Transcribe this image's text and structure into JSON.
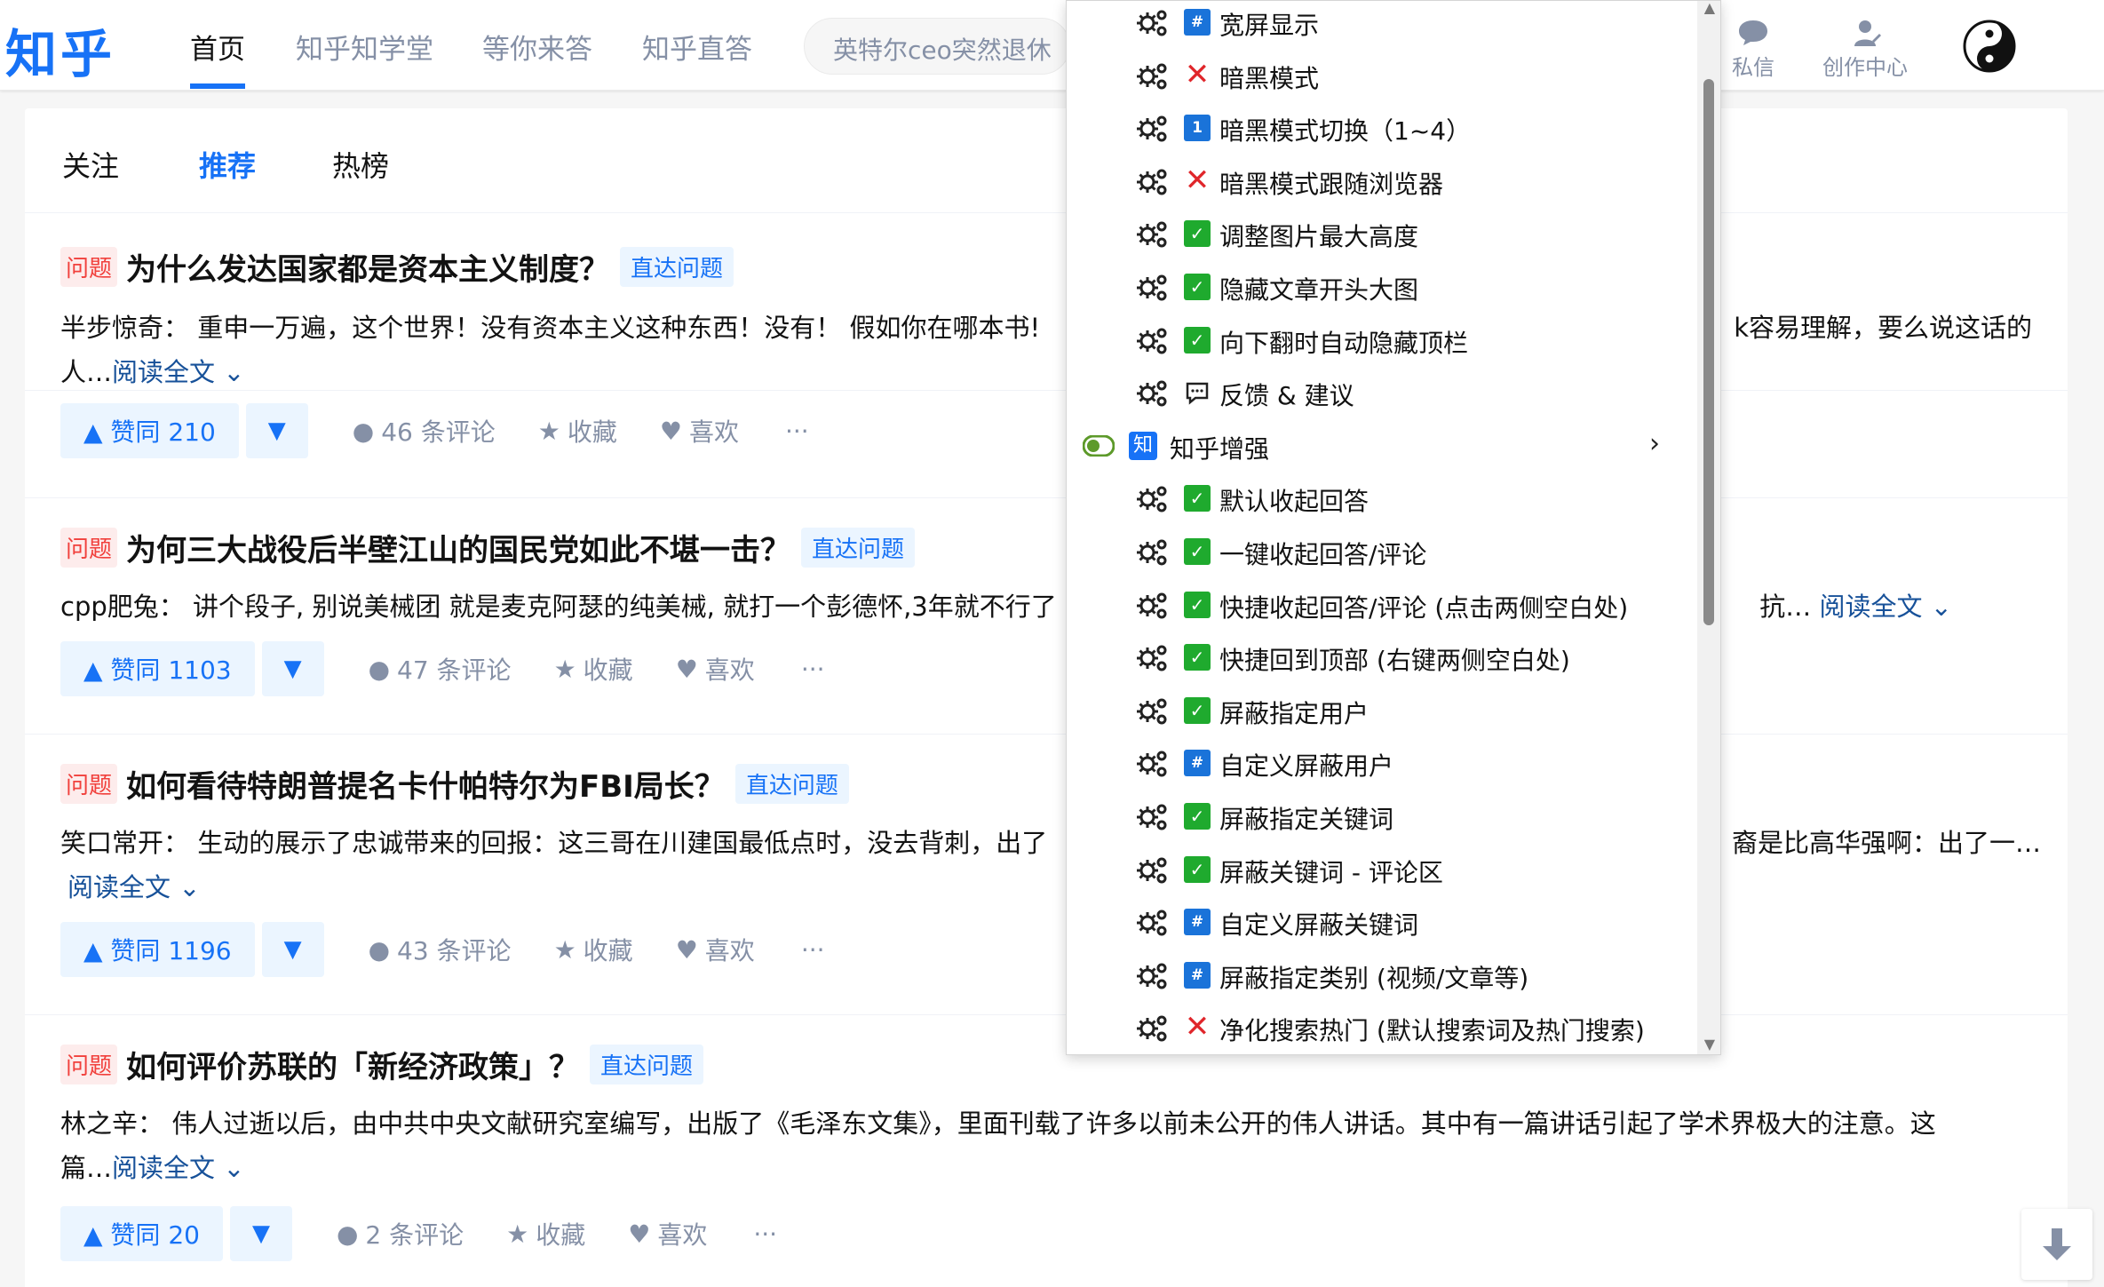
{
  "header": {
    "logo": "知乎",
    "nav": [
      "首页",
      "知乎知学堂",
      "等你来答",
      "知乎直答"
    ],
    "search_placeholder": "英特尔ceo突然退休",
    "messages": "私信",
    "creator": "创作中心"
  },
  "tabs": [
    "关注",
    "推荐",
    "热榜"
  ],
  "feed": [
    {
      "tag": "问题",
      "title": "为什么发达国家都是资本主义制度？",
      "link": "直达问题",
      "excerpt_left": "半步惊奇： 重申一万遍，这个世界！没有资本主义这种东西！没有！ 假如你在哪本书!",
      "excerpt_right": "k容易理解，要么说这话的",
      "excerpt_line2": "人…",
      "read_more": "阅读全文 ⌄",
      "votes": "▲ 赞同 210",
      "comments": "46 条评论",
      "favorite": "收藏",
      "like": "喜欢",
      "more": "···"
    },
    {
      "tag": "问题",
      "title": "为何三大战役后半壁江山的国民党如此不堪一击？",
      "link": "直达问题",
      "excerpt_left": "cpp肥兔： 讲个段子, 别说美械团 就是麦克阿瑟的纯美械, 就打一个彭德怀,3年就不行了",
      "excerpt_right": "抗…",
      "excerpt_line2": "",
      "read_more": "阅读全文 ⌄",
      "votes": "▲ 赞同 1103",
      "comments": "47 条评论",
      "favorite": "收藏",
      "like": "喜欢",
      "more": "···"
    },
    {
      "tag": "问题",
      "title": "如何看待特朗普提名卡什帕特尔为FBI局长？",
      "link": "直达问题",
      "excerpt_left": "笑口常开： 生动的展示了忠诚带来的回报：这三哥在川建国最低点时，没去背刺，出了",
      "excerpt_right": "裔是比高华强啊：出了一…",
      "excerpt_line2": "",
      "read_more": "阅读全文 ⌄",
      "votes": "▲ 赞同 1196",
      "comments": "43 条评论",
      "favorite": "收藏",
      "like": "喜欢",
      "more": "···"
    },
    {
      "tag": "问题",
      "title": "如何评价苏联的「新经济政策」？",
      "link": "直达问题",
      "excerpt_left": "林之辛： 伟人过逝以后，由中共中央文献研究室编写，出版了《毛泽东文集》，里面刊载了许多以前未公开的伟人讲话。其中有一篇讲话引起了学术界极大的注意。这",
      "excerpt_right": "",
      "excerpt_line2": "篇…",
      "read_more": "阅读全文 ⌄",
      "votes": "▲ 赞同 20",
      "comments": "2 条评论",
      "favorite": "收藏",
      "like": "喜欢",
      "more": "···"
    }
  ],
  "menu": {
    "items": [
      {
        "state": "num",
        "mark": "#",
        "label": "宽屏显示"
      },
      {
        "state": "off",
        "mark": "✕",
        "label": "暗黑模式"
      },
      {
        "state": "num",
        "mark": "1",
        "label": "暗黑模式切换（1~4）"
      },
      {
        "state": "off",
        "mark": "✕",
        "label": "暗黑模式跟随浏览器"
      },
      {
        "state": "on",
        "mark": "✓",
        "label": "调整图片最大高度"
      },
      {
        "state": "on",
        "mark": "✓",
        "label": "隐藏文章开头大图"
      },
      {
        "state": "on",
        "mark": "✓",
        "label": "向下翻时自动隐藏顶栏"
      },
      {
        "state": "chat",
        "mark": "",
        "label": "反馈 & 建议"
      }
    ],
    "group_icon": "知",
    "group_label": "知乎增强",
    "group_items": [
      {
        "state": "on",
        "mark": "✓",
        "label": "默认收起回答"
      },
      {
        "state": "on",
        "mark": "✓",
        "label": "一键收起回答/评论"
      },
      {
        "state": "on",
        "mark": "✓",
        "label": "快捷收起回答/评论 (点击两侧空白处)"
      },
      {
        "state": "on",
        "mark": "✓",
        "label": "快捷回到顶部 (右键两侧空白处)"
      },
      {
        "state": "on",
        "mark": "✓",
        "label": "屏蔽指定用户"
      },
      {
        "state": "num",
        "mark": "#",
        "label": "自定义屏蔽用户"
      },
      {
        "state": "on",
        "mark": "✓",
        "label": "屏蔽指定关键词"
      },
      {
        "state": "on",
        "mark": "✓",
        "label": "屏蔽关键词 - 评论区"
      },
      {
        "state": "num",
        "mark": "#",
        "label": "自定义屏蔽关键词"
      },
      {
        "state": "num",
        "mark": "#",
        "label": "屏蔽指定类别 (视频/文章等)"
      },
      {
        "state": "off",
        "mark": "✕",
        "label": "净化搜索热门 (默认搜索词及热门搜索)"
      }
    ]
  },
  "colors": {
    "brand": "#1772f6",
    "on": "#1faa2e",
    "off": "#e0262b"
  }
}
